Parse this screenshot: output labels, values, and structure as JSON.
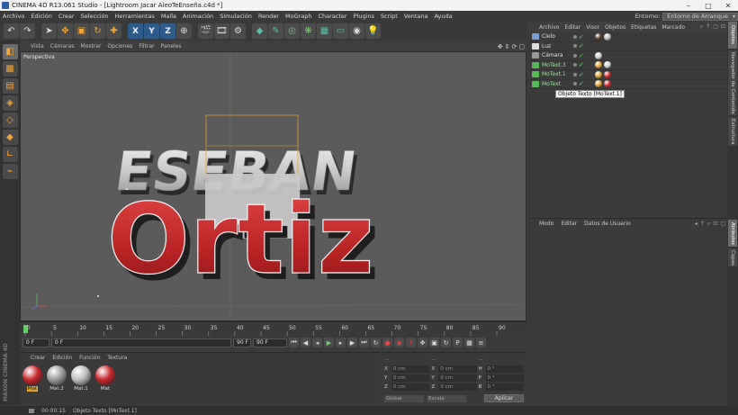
{
  "window": {
    "title": "CINEMA 4D R13.061 Studio - [Lightroom Jacar AleoTeEnseña.c4d *]",
    "controls": [
      "–",
      "□",
      "✕"
    ]
  },
  "menu": {
    "items": [
      "Archivo",
      "Edición",
      "Crear",
      "Selección",
      "Herramientas",
      "Malla",
      "Animación",
      "Simulación",
      "Render",
      "MoGraph",
      "Character",
      "Plugins",
      "Script",
      "Ventana",
      "Ayuda"
    ],
    "env_label": "Entorno:",
    "env_value": "Entorno de Arranque"
  },
  "toolbar": {
    "axis_x": "X",
    "axis_y": "Y",
    "axis_z": "Z"
  },
  "viewport": {
    "menu": [
      "Vista",
      "Cámaras",
      "Mostrar",
      "Opciones",
      "Filtrar",
      "Paneles"
    ],
    "camera_label": "Perspectiva",
    "text_top": "ESEBAN",
    "text_bottom": "Ortiz"
  },
  "timeline": {
    "ticks": [
      "0",
      "5",
      "10",
      "15",
      "20",
      "25",
      "30",
      "35",
      "40",
      "45",
      "50",
      "55",
      "60",
      "65",
      "70",
      "75",
      "80",
      "85",
      "90"
    ]
  },
  "transport": {
    "current_frame": "0 F",
    "start_frame": "0 F",
    "end_frame": "90 F",
    "max_frame": "90 F"
  },
  "materials": {
    "menu": [
      "Crear",
      "Edición",
      "Función",
      "Textura"
    ],
    "items": [
      {
        "name": "Mat",
        "color": "#c8262a",
        "selected": true
      },
      {
        "name": "Mat.2",
        "color": "#9a9a9a",
        "selected": false
      },
      {
        "name": "Mat.1",
        "color": "#bdbdbd",
        "selected": false
      },
      {
        "name": "Mat",
        "color": "#c8262a",
        "selected": false
      }
    ]
  },
  "coordinates": {
    "headers": [
      "—",
      "—",
      "—"
    ],
    "rows": [
      {
        "axis": "X",
        "pos": "0 cm",
        "axis2": "X",
        "size": "0 cm",
        "axis3": "H",
        "rot": "0 °"
      },
      {
        "axis": "Y",
        "pos": "0 cm",
        "axis2": "Y",
        "size": "0 cm",
        "axis3": "P",
        "rot": "0 °"
      },
      {
        "axis": "Z",
        "pos": "0 cm",
        "axis2": "Z",
        "size": "0 cm",
        "axis3": "B",
        "rot": "0 °"
      }
    ],
    "mode1": "Global",
    "mode2": "Escala",
    "apply_label": "Aplicar"
  },
  "status": {
    "time": "00:00:15",
    "message": "Objeto Texto [MoText.1]"
  },
  "brand": "MAXON CINEMA 4D",
  "objects": {
    "menu": [
      "Archivo",
      "Editar",
      "Visor",
      "Objetos",
      "Etiquetas",
      "Marcado"
    ],
    "rows": [
      {
        "name": "Cielo",
        "icon_color": "#7aa0d8",
        "green": false,
        "tags": [
          "#5a3a2a",
          "#bbbbbb"
        ]
      },
      {
        "name": "Luz",
        "icon_color": "#dddddd",
        "green": false,
        "tags": []
      },
      {
        "name": "Cámara",
        "icon_color": "#999999",
        "green": false,
        "tags": [
          "#cccccc"
        ]
      },
      {
        "name": "MoText.3",
        "icon_color": "#57b857",
        "green": true,
        "tags": [
          "#e0a030",
          "#cccccc"
        ]
      },
      {
        "name": "MoText.1",
        "icon_color": "#57b857",
        "green": true,
        "tags": [
          "#e0a030",
          "#cc2a2a"
        ]
      },
      {
        "name": "MoText",
        "icon_color": "#57b857",
        "green": true,
        "tags": [
          "#e0a030",
          "#cc2a2a"
        ]
      }
    ],
    "tooltip": "Objeto Texto [MoText.1]"
  },
  "attributes": {
    "menu": [
      "Modo",
      "Editar",
      "Datos de Usuario"
    ]
  },
  "side_tabs": [
    "Objetos",
    "Navegador de Contenido",
    "Estructura",
    "Atributos",
    "Capas"
  ]
}
